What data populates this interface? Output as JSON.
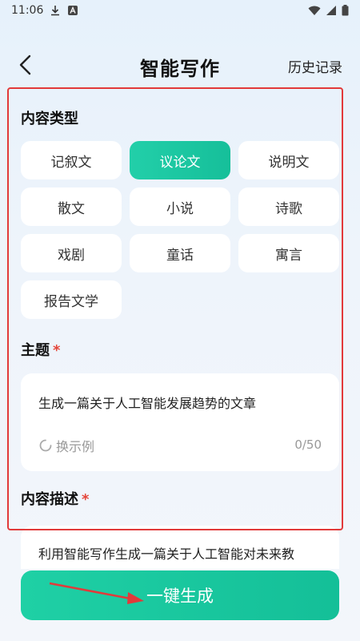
{
  "status": {
    "time": "11:06"
  },
  "header": {
    "title": "智能写作",
    "history": "历史记录"
  },
  "content_type": {
    "title": "内容类型",
    "options": [
      "记叙文",
      "议论文",
      "说明文",
      "散文",
      "小说",
      "诗歌",
      "戏剧",
      "童话",
      "寓言",
      "报告文学"
    ],
    "selected": "议论文"
  },
  "topic": {
    "title": "主题",
    "required_mark": "*",
    "value": "生成一篇关于人工智能发展趋势的文章",
    "example_label": "换示例",
    "counter": "0/50"
  },
  "description": {
    "title": "内容描述",
    "required_mark": "*",
    "value": "利用智能写作生成一篇关于人工智能对未来教"
  },
  "generate_label": "一键生成",
  "colors": {
    "accent": "#1cc9a2",
    "highlight": "#e23a3a",
    "required": "#e4453a"
  }
}
